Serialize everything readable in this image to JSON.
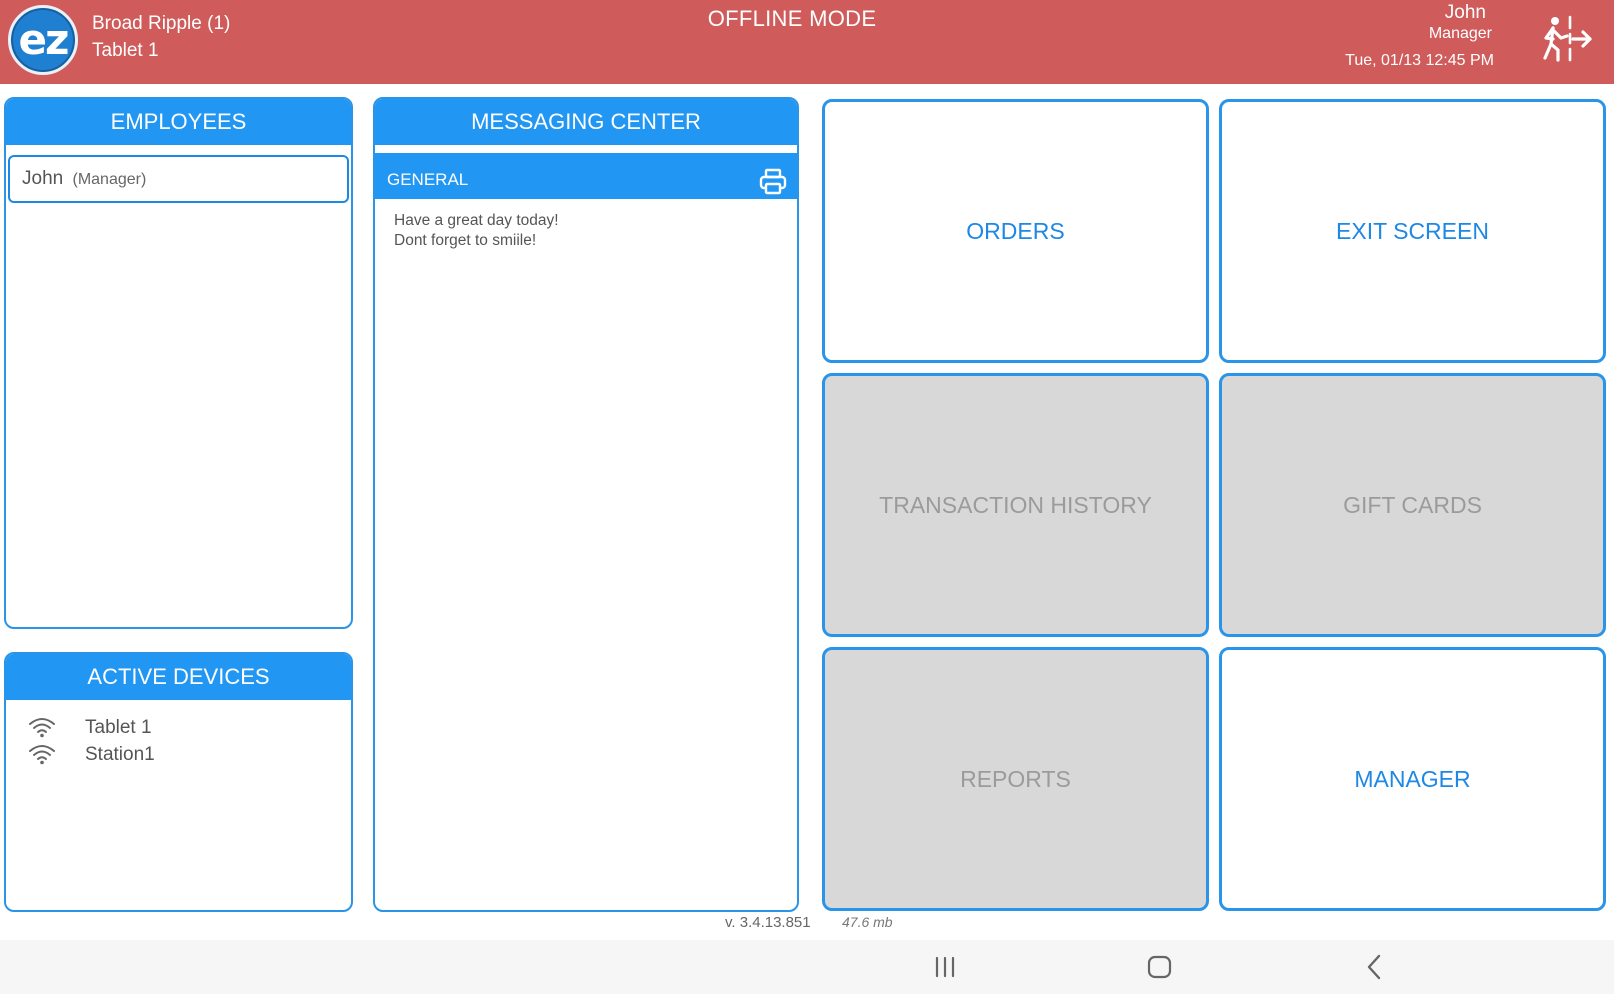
{
  "header": {
    "store_name": "Broad Ripple (1)",
    "device_name": "Tablet 1",
    "mode": "OFFLINE MODE",
    "user_name": "John",
    "user_role": "Manager",
    "datetime": "Tue, 01/13 12:45 PM",
    "logo_text": "ez",
    "exit_icon": "exit-running-man-icon"
  },
  "employees": {
    "title": "EMPLOYEES",
    "items": [
      {
        "name": "John",
        "role": "(Manager)"
      }
    ]
  },
  "active_devices": {
    "title": "ACTIVE DEVICES",
    "items": [
      {
        "name": "Tablet 1",
        "icon": "wifi-icon"
      },
      {
        "name": "Station1",
        "icon": "wifi-icon"
      }
    ]
  },
  "messaging": {
    "title": "MESSAGING CENTER",
    "channel": "GENERAL",
    "print_icon": "printer-icon",
    "lines": [
      "Have a great day today!",
      "Dont forget to smiile!"
    ]
  },
  "tiles": [
    {
      "label": "ORDERS",
      "enabled": true
    },
    {
      "label": "EXIT SCREEN",
      "enabled": true
    },
    {
      "label": "TRANSACTION HISTORY",
      "enabled": false
    },
    {
      "label": "GIFT CARDS",
      "enabled": false
    },
    {
      "label": "REPORTS",
      "enabled": false
    },
    {
      "label": "MANAGER",
      "enabled": true
    }
  ],
  "footer": {
    "version": "v. 3.4.13.851",
    "memory": "47.6  mb"
  },
  "navbar": {
    "recents_icon": "recent-apps-icon",
    "home_icon": "home-icon",
    "back_icon": "back-icon"
  },
  "colors": {
    "header_bg": "#cf5b5b",
    "accent": "#2196f3",
    "disabled_tile": "#d8d8d8"
  }
}
